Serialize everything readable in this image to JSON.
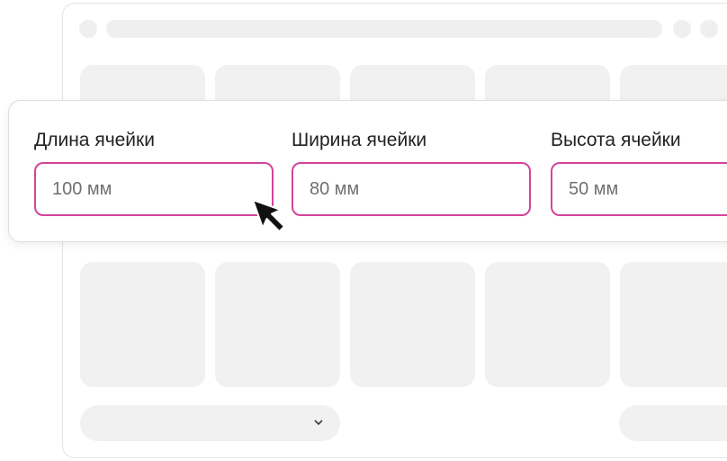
{
  "fields": [
    {
      "label": "Длина ячейки",
      "placeholder": "100 мм"
    },
    {
      "label": "Ширина ячейки",
      "placeholder": "80 мм"
    },
    {
      "label": "Высота ячейки",
      "placeholder": "50 мм"
    }
  ],
  "icons": {
    "dropdown": "chevron-down-icon",
    "pointer": "mouse-cursor-icon"
  },
  "colors": {
    "accent": "#d4449a",
    "placeholder_block": "#f1f1f1"
  }
}
